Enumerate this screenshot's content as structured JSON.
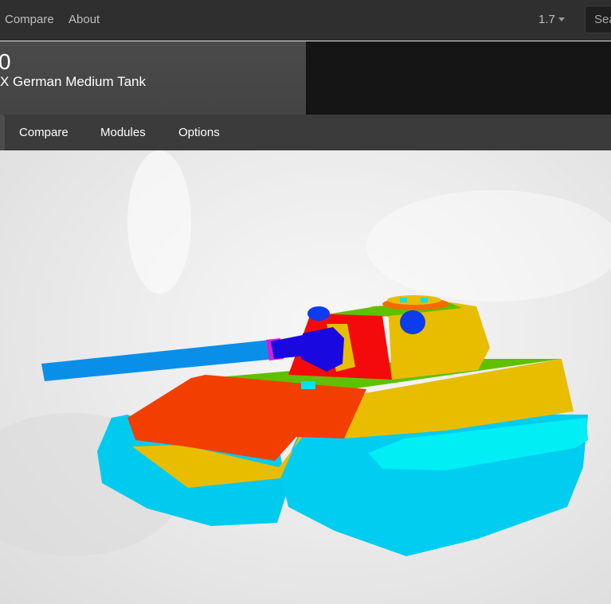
{
  "navbar": {
    "links": [
      "Compare",
      "About"
    ],
    "version": "1.7",
    "search_placeholder": "Sea"
  },
  "header": {
    "name": "0",
    "subtitle": "X German Medium Tank"
  },
  "tabs": [
    "Compare",
    "Modules",
    "Options"
  ],
  "viewer": {
    "colors": {
      "gun": "#0a8fe8",
      "mantlet": "#1a08e0",
      "orange": "#f23f00",
      "red": "#f40a0a",
      "yellow": "#e8bd00",
      "green": "#5fc000",
      "cyan": "#00d2ef",
      "blue": "#0b3cf0",
      "magenta": "#d020d8"
    }
  }
}
